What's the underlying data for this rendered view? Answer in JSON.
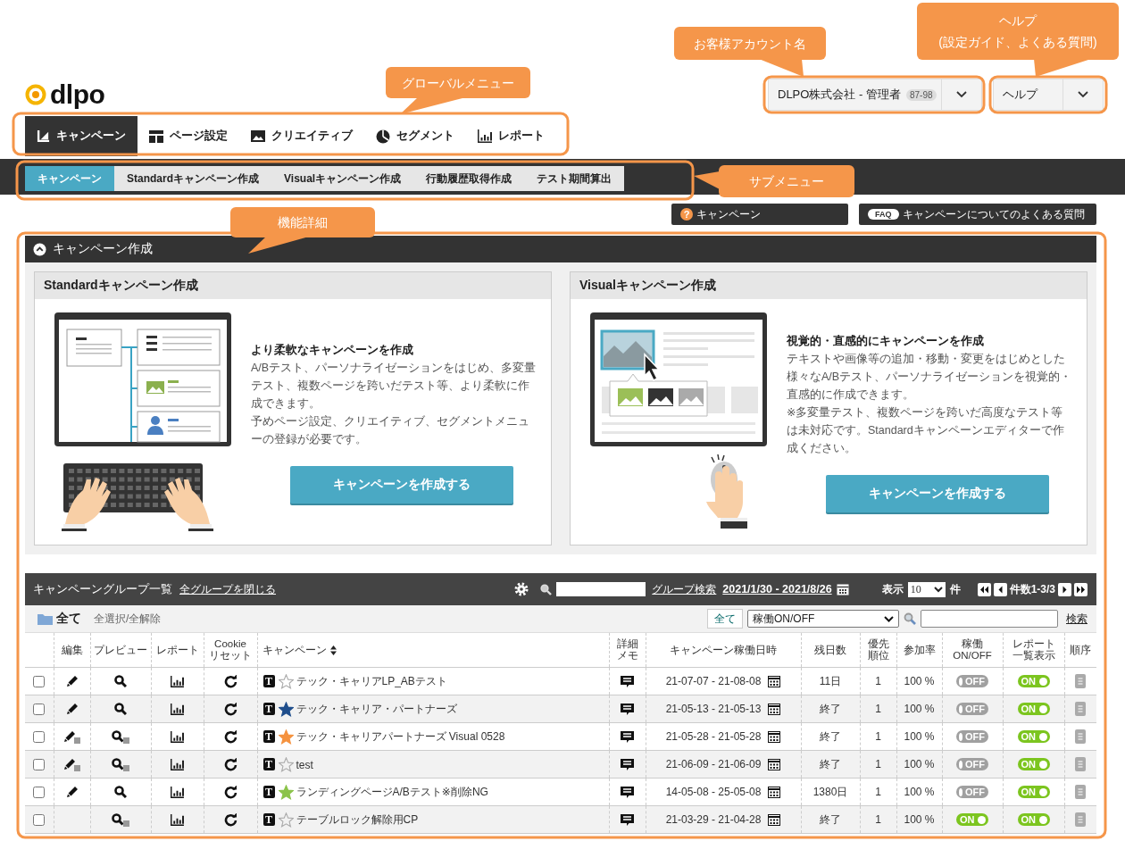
{
  "callouts": [
    {
      "text": "グローバルメニュー"
    },
    {
      "text": "お客様アカウント名"
    },
    {
      "text": "ヘルプ\n(設定ガイド、よくある質問)"
    },
    {
      "text": "サブメニュー"
    },
    {
      "text": "機能詳細"
    }
  ],
  "logo": {
    "text": "dlpo"
  },
  "account": {
    "label": "DLPO株式会社 - 管理者",
    "badge": "87-98"
  },
  "help_menu": {
    "label": "ヘルプ"
  },
  "global_menu": [
    {
      "label": "キャンペーン",
      "kind": "campaign",
      "selected": true
    },
    {
      "label": "ページ設定",
      "kind": "page",
      "selected": false
    },
    {
      "label": "クリエイティブ",
      "kind": "creative",
      "selected": false
    },
    {
      "label": "セグメント",
      "kind": "segment",
      "selected": false
    },
    {
      "label": "レポート",
      "kind": "report",
      "selected": false
    }
  ],
  "sub_menu": [
    {
      "label": "キャンペーン",
      "selected": true
    },
    {
      "label": "Standardキャンペーン作成",
      "selected": false
    },
    {
      "label": "Visualキャンペーン作成",
      "selected": false
    },
    {
      "label": "行動履歴取得作成",
      "selected": false
    },
    {
      "label": "テスト期間算出",
      "selected": false
    }
  ],
  "help_links": [
    {
      "kind": "question",
      "icon_text": "?",
      "label": "キャンペーン"
    },
    {
      "kind": "faq",
      "icon_text": "FAQ",
      "label": "キャンペーンについてのよくある質問"
    }
  ],
  "panel": {
    "title": "キャンペーン作成",
    "expanded": true,
    "cards": [
      {
        "kind": "standard",
        "title": "Standardキャンペーン作成",
        "heading": "より柔軟なキャンペーンを作成",
        "paragraphs": [
          "A/Bテスト、パーソナライゼーションをはじめ、多変量テスト、複数ページを跨いだテスト等、より柔軟に作成できます。",
          "予めページ設定、クリエイティブ、セグメントメニューの登録が必要です。"
        ],
        "button": "キャンペーンを作成する"
      },
      {
        "kind": "visual",
        "title": "Visualキャンペーン作成",
        "heading": "視覚的・直感的にキャンペーンを作成",
        "paragraphs": [
          "テキストや画像等の追加・移動・変更をはじめとした様々なA/Bテスト、パーソナライゼーションを視覚的・直感的に作成できます。",
          "※多変量テスト、複数ページを跨いだ高度なテスト等は未対応です。Standardキャンペーンエディターで作成ください。"
        ],
        "button": "キャンペーンを作成する"
      }
    ]
  },
  "campaign_groups": {
    "title": "キャンペーングループ一覧",
    "collapse_link": "全グループを閉じる",
    "group_search_link": "グループ検索",
    "date_range": "2021/1/30 - 2021/8/26",
    "page_size_label": "表示",
    "page_size": "10",
    "page_size_unit": "件",
    "count": "件数1-3/3",
    "folder": "全て",
    "select_toggle": "全選択/全解除",
    "filter_button": "全て",
    "status_filter": "稼働ON/OFF",
    "search_link": "検索",
    "columns": [
      {
        "lines": [
          "編集"
        ],
        "sortable": false
      },
      {
        "lines": [
          "プレビュー"
        ],
        "sortable": false
      },
      {
        "lines": [
          "レポート"
        ],
        "sortable": false
      },
      {
        "lines": [
          "Cookie",
          "リセット"
        ],
        "sortable": false
      },
      {
        "lines": [
          "キャンペーン"
        ],
        "sortable": true
      },
      {
        "lines": [
          "詳細",
          "メモ"
        ],
        "sortable": false
      },
      {
        "lines": [
          "キャンペーン稼働日時"
        ],
        "sortable": false
      },
      {
        "lines": [
          "残日数"
        ],
        "sortable": false
      },
      {
        "lines": [
          "優先",
          "順位"
        ],
        "sortable": false
      },
      {
        "lines": [
          "参加率"
        ],
        "sortable": false
      },
      {
        "lines": [
          "稼働",
          "ON/OFF"
        ],
        "sortable": false
      },
      {
        "lines": [
          "レポート",
          "一覧表示"
        ],
        "sortable": false
      },
      {
        "lines": [
          "順序"
        ],
        "sortable": false
      }
    ],
    "rows": [
      {
        "checked": false,
        "edit": {
          "kind": "standard"
        },
        "preview": {
          "kind": "standard"
        },
        "type": "T",
        "starred": false,
        "name": "テック・キャリアLP_ABテスト",
        "dates": "21-07-07 - 21-08-08",
        "remaining": "11日",
        "priority": "1",
        "rate": "100 %",
        "running": {
          "on": false,
          "label": "OFF"
        },
        "report": {
          "on": true,
          "label": "ON"
        }
      },
      {
        "checked": false,
        "edit": {
          "kind": "standard"
        },
        "preview": {
          "kind": "standard"
        },
        "type": "T",
        "starred": true,
        "color": "#1f4e8c",
        "name": "テック・キャリア・パートナーズ",
        "dates": "21-05-13 - 21-05-13",
        "remaining": "終了",
        "priority": "1",
        "rate": "100 %",
        "running": {
          "on": false,
          "label": "OFF"
        },
        "report": {
          "on": true,
          "label": "ON"
        }
      },
      {
        "checked": false,
        "edit": {
          "kind": "visual"
        },
        "preview": {
          "kind": "visual"
        },
        "type": "T",
        "starred": true,
        "color": "#f5923e",
        "name": "テック・キャリアパートナーズ Visual 0528",
        "dates": "21-05-28 - 21-05-28",
        "remaining": "終了",
        "priority": "1",
        "rate": "100 %",
        "running": {
          "on": false,
          "label": "OFF"
        },
        "report": {
          "on": true,
          "label": "ON"
        }
      },
      {
        "checked": false,
        "edit": {
          "kind": "visual"
        },
        "preview": {
          "kind": "visual"
        },
        "type": "T",
        "starred": false,
        "name": "test",
        "dates": "21-06-09 - 21-06-09",
        "remaining": "終了",
        "priority": "1",
        "rate": "100 %",
        "running": {
          "on": false,
          "label": "OFF"
        },
        "report": {
          "on": true,
          "label": "ON"
        }
      },
      {
        "checked": false,
        "edit": {
          "kind": "standard"
        },
        "preview": {
          "kind": "standard"
        },
        "type": "T",
        "starred": true,
        "color": "#8bc34a",
        "name": "ランディングページA/Bテスト※削除NG",
        "dates": "14-05-08 - 25-05-08",
        "remaining": "1380日",
        "priority": "1",
        "rate": "100 %",
        "running": {
          "on": false,
          "label": "OFF"
        },
        "report": {
          "on": true,
          "label": "ON"
        }
      },
      {
        "checked": false,
        "edit": {
          "kind": "none"
        },
        "preview": {
          "kind": "visual"
        },
        "type": "T",
        "starred": false,
        "name": "テーブルロック解除用CP",
        "dates": "21-03-29 - 21-04-28",
        "remaining": "終了",
        "priority": "1",
        "rate": "100 %",
        "running": {
          "on": true,
          "label": "ON"
        },
        "report": {
          "on": true,
          "label": "ON"
        }
      }
    ]
  }
}
